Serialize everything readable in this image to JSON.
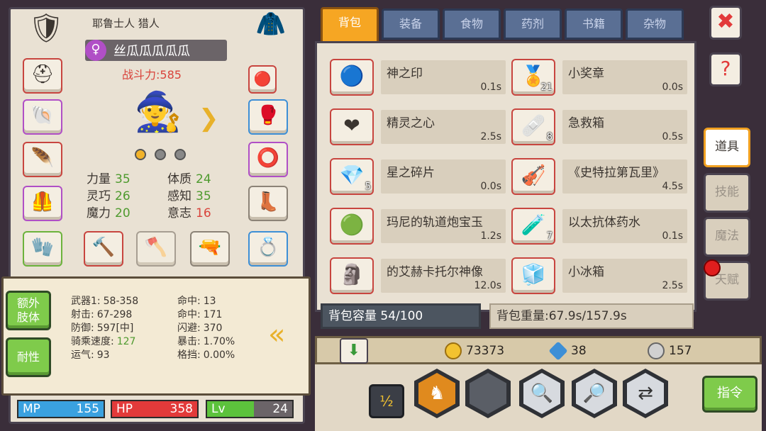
{
  "character": {
    "race_class": "耶鲁士人 猎人",
    "name": "丝瓜瓜瓜瓜瓜",
    "gender_icon": "female-icon",
    "combat_power": "战斗力:585",
    "stats": [
      {
        "label": "力量",
        "value": "35"
      },
      {
        "label": "体质",
        "value": "24"
      },
      {
        "label": "灵巧",
        "value": "26"
      },
      {
        "label": "感知",
        "value": "35"
      },
      {
        "label": "魔力",
        "value": "20"
      },
      {
        "label": "意志",
        "value": "16"
      }
    ]
  },
  "left_buttons": {
    "extra_limbs": "额外\n肢体",
    "resistance": "耐性"
  },
  "attributes": [
    {
      "label": "武器1:",
      "value": "58-358"
    },
    {
      "label": "命中:",
      "value": "13"
    },
    {
      "label": "射击:",
      "value": "67-298"
    },
    {
      "label": "命中:",
      "value": "171"
    },
    {
      "label": "防御:",
      "value": "597[中]"
    },
    {
      "label": "闪避:",
      "value": "370"
    },
    {
      "label": "骑乘速度:",
      "value": "127"
    },
    {
      "label": "暴击:",
      "value": "1.70%"
    },
    {
      "label": "运气:",
      "value": "93"
    },
    {
      "label": "格挡:",
      "value": "0.00%"
    }
  ],
  "bars": {
    "mp": {
      "label": "MP",
      "value": "155"
    },
    "hp": {
      "label": "HP",
      "value": "358"
    },
    "lv": {
      "label": "Lv",
      "value": "24"
    }
  },
  "tabs": [
    "背包",
    "装备",
    "食物",
    "药剂",
    "书籍",
    "杂物"
  ],
  "active_tab": 0,
  "items": [
    {
      "name": "神之印",
      "weight": "0.1s",
      "count": "",
      "icon": "seal-icon"
    },
    {
      "name": "小奖章",
      "weight": "0.0s",
      "count": "21",
      "icon": "medal-icon"
    },
    {
      "name": "精灵之心",
      "weight": "2.5s",
      "count": "",
      "icon": "heart-icon"
    },
    {
      "name": "急救箱",
      "weight": "0.5s",
      "count": "8",
      "icon": "firstaid-icon"
    },
    {
      "name": "星之碎片",
      "weight": "0.0s",
      "count": "5",
      "icon": "crystal-icon"
    },
    {
      "name": "《史特拉第瓦里》",
      "weight": "4.5s",
      "count": "",
      "icon": "violin-icon"
    },
    {
      "name": "玛尼的轨道炮宝玉",
      "weight": "1.2s",
      "count": "",
      "icon": "gem-icon"
    },
    {
      "name": "以太抗体药水",
      "weight": "0.1s",
      "count": "7",
      "icon": "potion-icon"
    },
    {
      "name": "的艾赫卡托尔神像",
      "weight": "12.0s",
      "count": "",
      "icon": "statue-icon"
    },
    {
      "name": "小冰箱",
      "weight": "2.5s",
      "count": "",
      "icon": "fridge-icon"
    }
  ],
  "bag_capacity": "背包容量 54/100",
  "bag_weight": "背包重量:67.9s/157.9s",
  "currency": {
    "gold": "73373",
    "gems": "38",
    "silver": "157"
  },
  "side_tabs": [
    "道具",
    "技能",
    "魔法",
    "天赋"
  ],
  "command_label": "指令",
  "colors": {
    "active_tab": "#f6a623",
    "mp_bar": "#3aa1e0",
    "hp_bar": "#e23a3a",
    "lv_bar": "#5cc23c",
    "power_text": "#d9433b"
  }
}
